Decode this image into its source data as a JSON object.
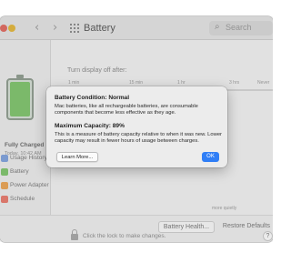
{
  "window": {
    "title": "Battery",
    "search_placeholder": "Search"
  },
  "sidebar": {
    "status": "Fully Charged",
    "time": "Today, 10:42 AM",
    "battery_level": 1.0,
    "items": [
      {
        "label": "Usage History",
        "icon": "chart-icon",
        "color": "#7f9fd6"
      },
      {
        "label": "Battery",
        "icon": "battery-icon",
        "color": "#7fbf6e"
      },
      {
        "label": "Power Adapter",
        "icon": "plug-icon",
        "color": "#e3a258"
      },
      {
        "label": "Schedule",
        "icon": "calendar-icon",
        "color": "#e07a6e"
      }
    ]
  },
  "content": {
    "turn_off_label": "Turn display off after:",
    "ticks": [
      "1 min",
      "15 min",
      "1 hr",
      "3 hrs",
      "Never"
    ],
    "optimize_hint": "more quietly",
    "battery_health_button": "Battery Health...",
    "restore_defaults_button": "Restore Defaults",
    "lock_text": "Click the lock to make changes.",
    "help": "?"
  },
  "dialog": {
    "condition_title": "Battery Condition: Normal",
    "condition_text": "Mac batteries, like all rechargeable batteries, are consumable components that become less effective as they age.",
    "capacity_title": "Maximum Capacity: 89%",
    "capacity_text": "This is a measure of battery capacity relative to when it was new. Lower capacity may result in fewer hours of usage between charges.",
    "learn_more_button": "Learn More...",
    "ok_button": "OK"
  },
  "colors": {
    "accent": "#2f7ef6",
    "battery_green": "#7fbf6e"
  }
}
